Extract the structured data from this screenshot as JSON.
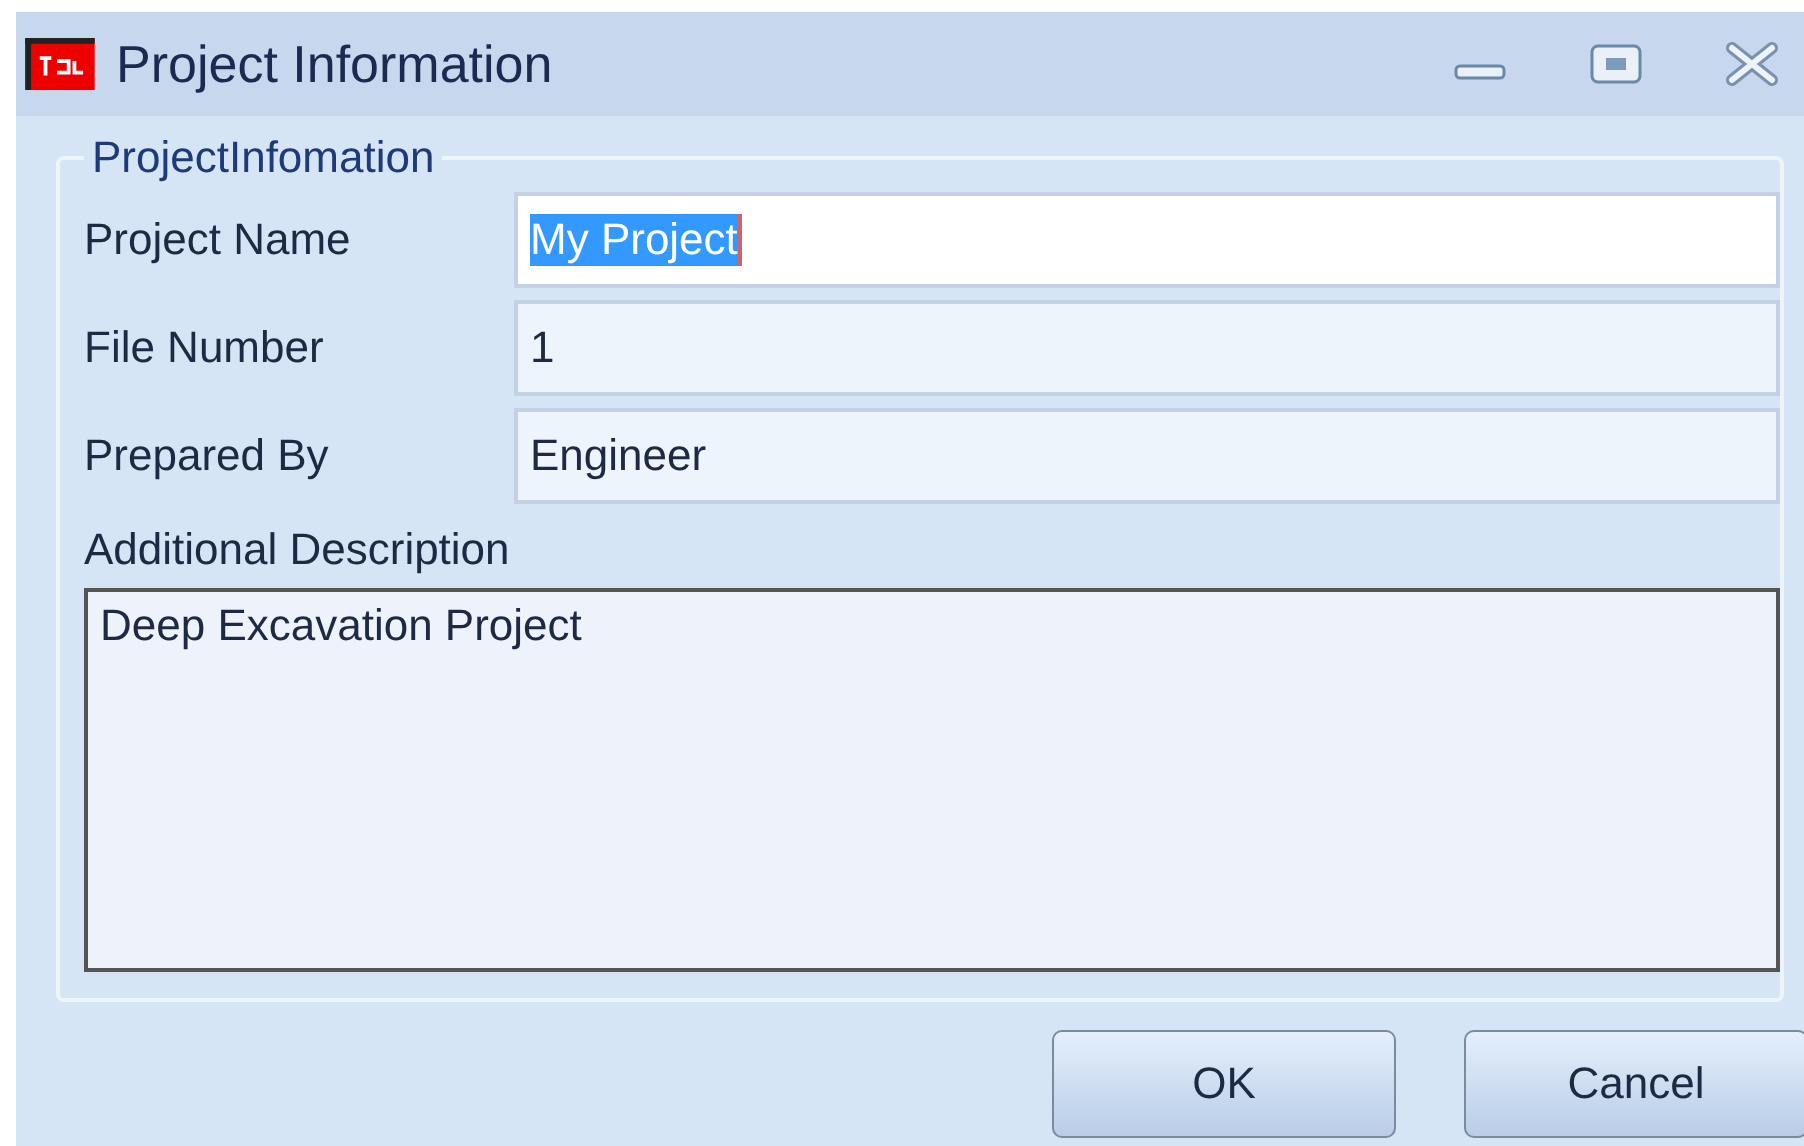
{
  "window": {
    "title": "Project Information"
  },
  "group": {
    "legend": "ProjectInfomation"
  },
  "fields": [
    {
      "label": "Project Name",
      "value": "My Project",
      "focused": true,
      "text_selected": true
    },
    {
      "label": "File Number",
      "value": "1",
      "focused": false,
      "text_selected": false
    },
    {
      "label": "Prepared By",
      "value": "Engineer",
      "focused": false,
      "text_selected": false
    }
  ],
  "description": {
    "label": "Additional Description",
    "value": "Deep Excavation Project"
  },
  "buttons": [
    "OK",
    "Cancel"
  ]
}
